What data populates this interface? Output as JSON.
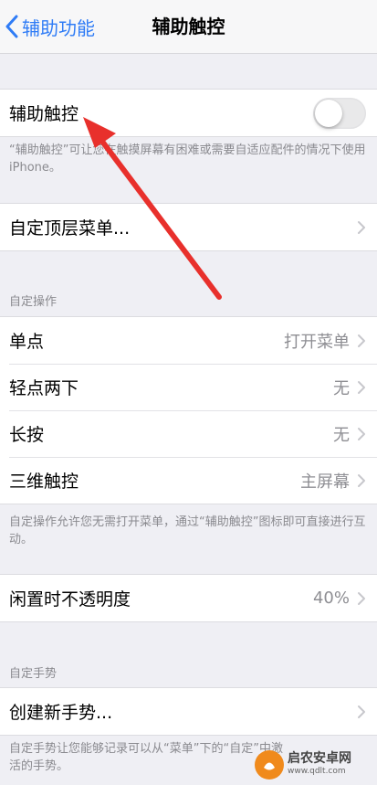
{
  "nav": {
    "back_label": "辅助功能",
    "title": "辅助触控"
  },
  "assistive_touch": {
    "label": "辅助触控",
    "enabled": false,
    "footer": "“辅助触控”可让您在触摸屏幕有困难或需要自适应配件的情况下使用 iPhone。"
  },
  "customize_menu": {
    "label": "自定顶层菜单..."
  },
  "custom_actions": {
    "header": "自定操作",
    "items": [
      {
        "label": "单点",
        "value": "打开菜单"
      },
      {
        "label": "轻点两下",
        "value": "无"
      },
      {
        "label": "长按",
        "value": "无"
      },
      {
        "label": "三维触控",
        "value": "主屏幕"
      }
    ],
    "footer": "自定操作允许您无需打开菜单，通过“辅助触控”图标即可直接进行互动。"
  },
  "idle_opacity": {
    "label": "闲置时不透明度",
    "value": "40%"
  },
  "custom_gestures": {
    "header": "自定手势",
    "create_label": "创建新手势...",
    "footer": "自定手势让您能够记录可以从“菜单”下的“自定”中激活的手势。"
  },
  "watermark": {
    "main": "启农安卓网",
    "sub": "www.qdlt.com"
  },
  "colors": {
    "accent": "#2f7cf6",
    "arrow": "#e8302c",
    "background": "#efeff4"
  }
}
